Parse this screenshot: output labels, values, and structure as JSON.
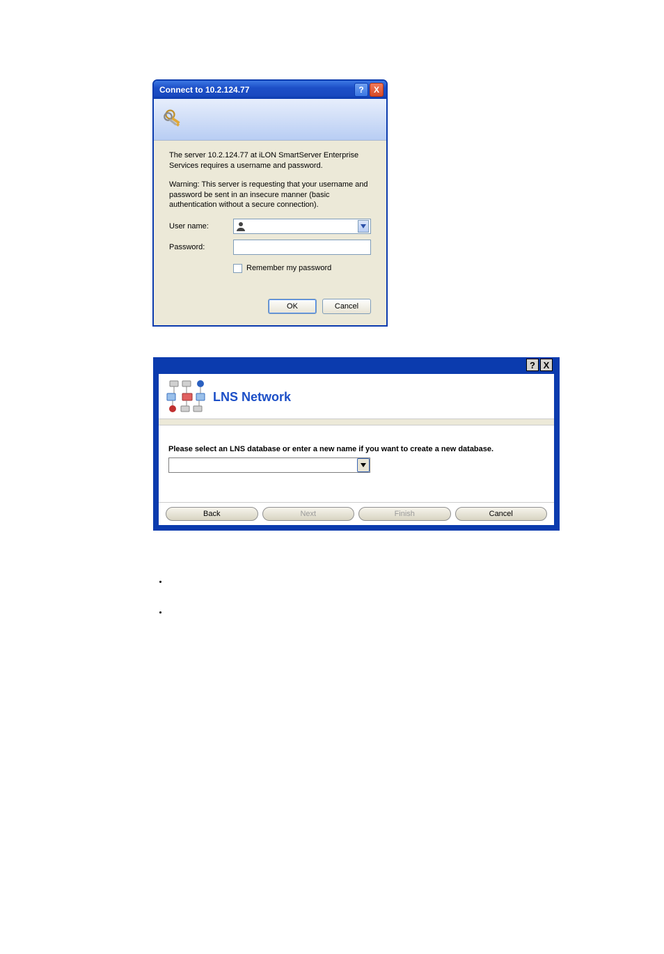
{
  "connect_dialog": {
    "title": "Connect to 10.2.124.77",
    "server_text": "The server 10.2.124.77 at iLON SmartServer Enterprise Services requires a username and password.",
    "warning_text": "Warning: This server is requesting that your username and password be sent in an insecure manner (basic authentication without a secure connection).",
    "username_label": "User name:",
    "password_label": "Password:",
    "username_value": "",
    "password_value": "",
    "remember_label": "Remember my password",
    "ok_label": "OK",
    "cancel_label": "Cancel",
    "help_symbol": "?",
    "close_symbol": "X"
  },
  "lns_dialog": {
    "title": "LNS Network",
    "instruction": "Please select an LNS database or enter a new name if you want to create a new database.",
    "select_value": "",
    "back_label": "Back",
    "next_label": "Next",
    "finish_label": "Finish",
    "cancel_label": "Cancel",
    "help_symbol": "?",
    "close_symbol": "X"
  }
}
